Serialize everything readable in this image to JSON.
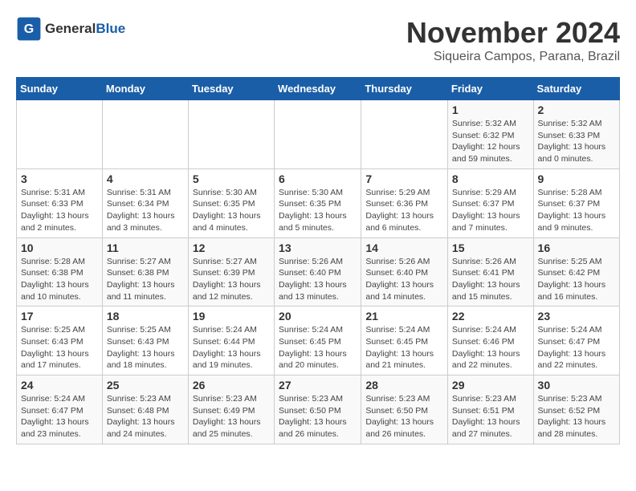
{
  "logo": {
    "text_general": "General",
    "text_blue": "Blue"
  },
  "title": "November 2024",
  "subtitle": "Siqueira Campos, Parana, Brazil",
  "weekdays": [
    "Sunday",
    "Monday",
    "Tuesday",
    "Wednesday",
    "Thursday",
    "Friday",
    "Saturday"
  ],
  "weeks": [
    [
      {
        "day": "",
        "info": ""
      },
      {
        "day": "",
        "info": ""
      },
      {
        "day": "",
        "info": ""
      },
      {
        "day": "",
        "info": ""
      },
      {
        "day": "",
        "info": ""
      },
      {
        "day": "1",
        "info": "Sunrise: 5:32 AM\nSunset: 6:32 PM\nDaylight: 12 hours and 59 minutes."
      },
      {
        "day": "2",
        "info": "Sunrise: 5:32 AM\nSunset: 6:33 PM\nDaylight: 13 hours and 0 minutes."
      }
    ],
    [
      {
        "day": "3",
        "info": "Sunrise: 5:31 AM\nSunset: 6:33 PM\nDaylight: 13 hours and 2 minutes."
      },
      {
        "day": "4",
        "info": "Sunrise: 5:31 AM\nSunset: 6:34 PM\nDaylight: 13 hours and 3 minutes."
      },
      {
        "day": "5",
        "info": "Sunrise: 5:30 AM\nSunset: 6:35 PM\nDaylight: 13 hours and 4 minutes."
      },
      {
        "day": "6",
        "info": "Sunrise: 5:30 AM\nSunset: 6:35 PM\nDaylight: 13 hours and 5 minutes."
      },
      {
        "day": "7",
        "info": "Sunrise: 5:29 AM\nSunset: 6:36 PM\nDaylight: 13 hours and 6 minutes."
      },
      {
        "day": "8",
        "info": "Sunrise: 5:29 AM\nSunset: 6:37 PM\nDaylight: 13 hours and 7 minutes."
      },
      {
        "day": "9",
        "info": "Sunrise: 5:28 AM\nSunset: 6:37 PM\nDaylight: 13 hours and 9 minutes."
      }
    ],
    [
      {
        "day": "10",
        "info": "Sunrise: 5:28 AM\nSunset: 6:38 PM\nDaylight: 13 hours and 10 minutes."
      },
      {
        "day": "11",
        "info": "Sunrise: 5:27 AM\nSunset: 6:38 PM\nDaylight: 13 hours and 11 minutes."
      },
      {
        "day": "12",
        "info": "Sunrise: 5:27 AM\nSunset: 6:39 PM\nDaylight: 13 hours and 12 minutes."
      },
      {
        "day": "13",
        "info": "Sunrise: 5:26 AM\nSunset: 6:40 PM\nDaylight: 13 hours and 13 minutes."
      },
      {
        "day": "14",
        "info": "Sunrise: 5:26 AM\nSunset: 6:40 PM\nDaylight: 13 hours and 14 minutes."
      },
      {
        "day": "15",
        "info": "Sunrise: 5:26 AM\nSunset: 6:41 PM\nDaylight: 13 hours and 15 minutes."
      },
      {
        "day": "16",
        "info": "Sunrise: 5:25 AM\nSunset: 6:42 PM\nDaylight: 13 hours and 16 minutes."
      }
    ],
    [
      {
        "day": "17",
        "info": "Sunrise: 5:25 AM\nSunset: 6:43 PM\nDaylight: 13 hours and 17 minutes."
      },
      {
        "day": "18",
        "info": "Sunrise: 5:25 AM\nSunset: 6:43 PM\nDaylight: 13 hours and 18 minutes."
      },
      {
        "day": "19",
        "info": "Sunrise: 5:24 AM\nSunset: 6:44 PM\nDaylight: 13 hours and 19 minutes."
      },
      {
        "day": "20",
        "info": "Sunrise: 5:24 AM\nSunset: 6:45 PM\nDaylight: 13 hours and 20 minutes."
      },
      {
        "day": "21",
        "info": "Sunrise: 5:24 AM\nSunset: 6:45 PM\nDaylight: 13 hours and 21 minutes."
      },
      {
        "day": "22",
        "info": "Sunrise: 5:24 AM\nSunset: 6:46 PM\nDaylight: 13 hours and 22 minutes."
      },
      {
        "day": "23",
        "info": "Sunrise: 5:24 AM\nSunset: 6:47 PM\nDaylight: 13 hours and 22 minutes."
      }
    ],
    [
      {
        "day": "24",
        "info": "Sunrise: 5:24 AM\nSunset: 6:47 PM\nDaylight: 13 hours and 23 minutes."
      },
      {
        "day": "25",
        "info": "Sunrise: 5:23 AM\nSunset: 6:48 PM\nDaylight: 13 hours and 24 minutes."
      },
      {
        "day": "26",
        "info": "Sunrise: 5:23 AM\nSunset: 6:49 PM\nDaylight: 13 hours and 25 minutes."
      },
      {
        "day": "27",
        "info": "Sunrise: 5:23 AM\nSunset: 6:50 PM\nDaylight: 13 hours and 26 minutes."
      },
      {
        "day": "28",
        "info": "Sunrise: 5:23 AM\nSunset: 6:50 PM\nDaylight: 13 hours and 26 minutes."
      },
      {
        "day": "29",
        "info": "Sunrise: 5:23 AM\nSunset: 6:51 PM\nDaylight: 13 hours and 27 minutes."
      },
      {
        "day": "30",
        "info": "Sunrise: 5:23 AM\nSunset: 6:52 PM\nDaylight: 13 hours and 28 minutes."
      }
    ]
  ]
}
